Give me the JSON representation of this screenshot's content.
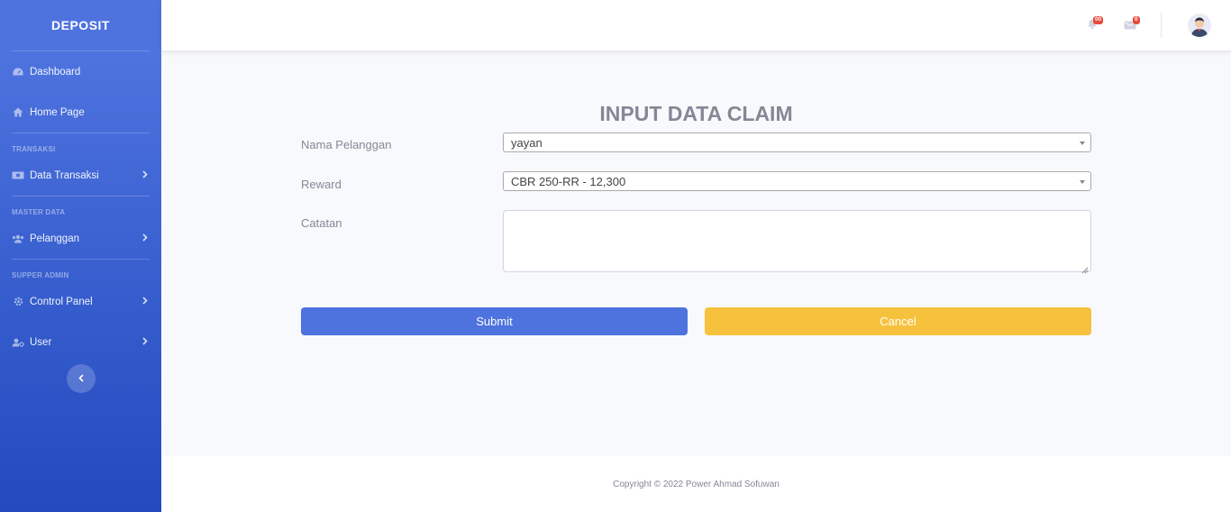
{
  "sidebar": {
    "brand": "DEPOSIT",
    "dashboard": "Dashboard",
    "home": "Home Page",
    "heading_transaksi": "TRANSAKSI",
    "data_transaksi": "Data Transaksi",
    "heading_master": "MASTER DATA",
    "pelanggan": "Pelanggan",
    "heading_admin": "SUPPER ADMIN",
    "control_panel": "Control Panel",
    "user": "User"
  },
  "topbar": {
    "alerts_count": "00",
    "messages_count": "0"
  },
  "form": {
    "title": "INPUT DATA CLAIM",
    "nama_label": "Nama Pelanggan",
    "nama_value": "yayan",
    "reward_label": "Reward",
    "reward_value": "CBR 250-RR - 12,300",
    "catatan_label": "Catatan",
    "catatan_value": "",
    "submit_label": "Submit",
    "cancel_label": "Cancel"
  },
  "footer": {
    "copyright": "Copyright © 2022 Power Ahmad Sofuwan"
  },
  "colors": {
    "primary": "#4e73df",
    "warning": "#f6c23e",
    "danger": "#e74a3b"
  }
}
